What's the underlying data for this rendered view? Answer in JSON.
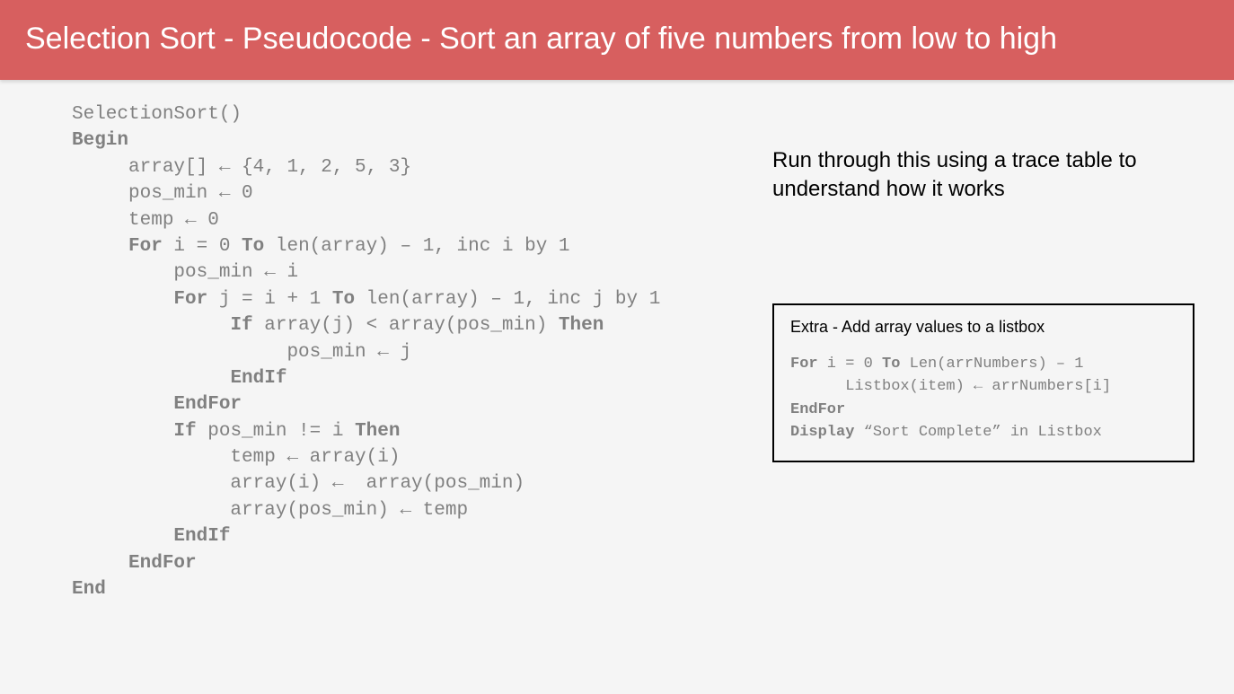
{
  "header": "Selection Sort - Pseudocode  - Sort an array of five numbers from low to high",
  "code": {
    "l01a": "SelectionSort()",
    "l02a": "Begin",
    "l03a": "     array[] ← {4, 1, 2, 5, 3}",
    "l04a": "     pos_min ← 0",
    "l05a": "     temp ← 0",
    "l06a": "     ",
    "l06b": "For",
    "l06c": " i = 0 ",
    "l06d": "To",
    "l06e": " len(array) – 1, inc i by 1",
    "l07a": "         pos_min ← i",
    "l08a": "         ",
    "l08b": "For",
    "l08c": " j = i + 1 ",
    "l08d": "To",
    "l08e": " len(array) – 1, inc j by 1",
    "l09a": "              ",
    "l09b": "If",
    "l09c": " array(j) < array(pos_min) ",
    "l09d": "Then",
    "l10a": "                   pos_min ← j",
    "l11a": "              ",
    "l11b": "EndIf",
    "l12a": "         ",
    "l12b": "EndFor",
    "l13a": "",
    "l14a": "         ",
    "l14b": "If",
    "l14c": " pos_min != i ",
    "l14d": "Then",
    "l15a": "              temp ← array(i)",
    "l16a": "              array(i) ←  array(pos_min)",
    "l17a": "              array(pos_min) ← temp",
    "l18a": "         ",
    "l18b": "EndIf",
    "l19a": "     ",
    "l19b": "EndFor",
    "l20a": "End"
  },
  "instruction": "Run through this using a trace table to understand how it works",
  "extra": {
    "title": "Extra - Add array values to a listbox",
    "e1a": "For",
    "e1b": " i = 0 ",
    "e1c": "To",
    "e1d": " Len(arrNumbers) – 1",
    "e2a": "      Listbox(item) ← arrNumbers[i]",
    "e3a": "EndFor",
    "e4a": "Display",
    "e4b": " “Sort Complete” in Listbox"
  }
}
